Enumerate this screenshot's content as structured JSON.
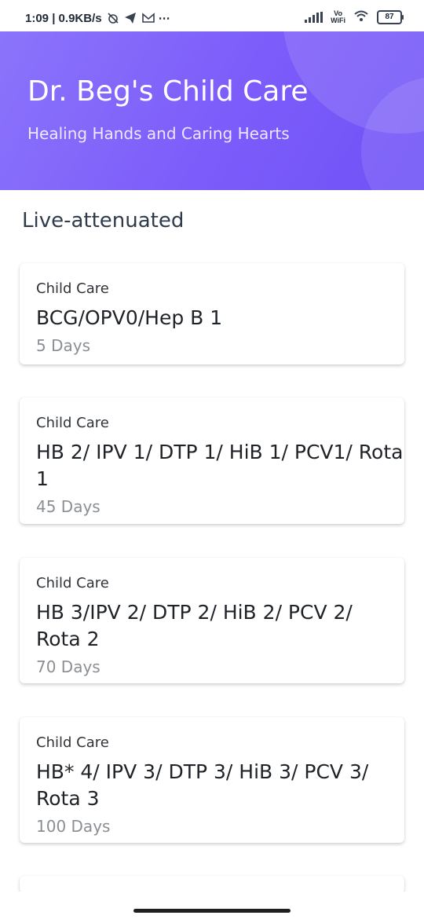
{
  "status_bar": {
    "time_speed": "1:09 | 0.9KB/s",
    "network_label_1": "Vo",
    "network_label_2": "WiFi",
    "battery": "87"
  },
  "header": {
    "title": "Dr. Beg's Child Care",
    "subtitle": "Healing Hands and Caring Hearts",
    "gradient_start": "#8b74fb",
    "gradient_end": "#6f52f7"
  },
  "section": {
    "title": "Live-attenuated"
  },
  "cards": [
    {
      "label": "Child Care",
      "name_line1": "BCG/OPV0/Hep B 1",
      "name_line2": "",
      "days": "5 Days"
    },
    {
      "label": "Child Care",
      "name_line1": "HB 2/ IPV 1/ DTP 1/ HiB 1/ PCV1/ Rota",
      "name_line2": "1",
      "days": "45 Days"
    },
    {
      "label": "Child Care",
      "name_line1": "HB 3/IPV 2/ DTP 2/ HiB 2/ PCV 2/",
      "name_line2": "Rota 2",
      "days": "70 Days"
    },
    {
      "label": "Child Care",
      "name_line1": "HB* 4/ IPV 3/ DTP 3/ HiB 3/ PCV 3/",
      "name_line2": "Rota 3",
      "days": "100 Days"
    }
  ]
}
